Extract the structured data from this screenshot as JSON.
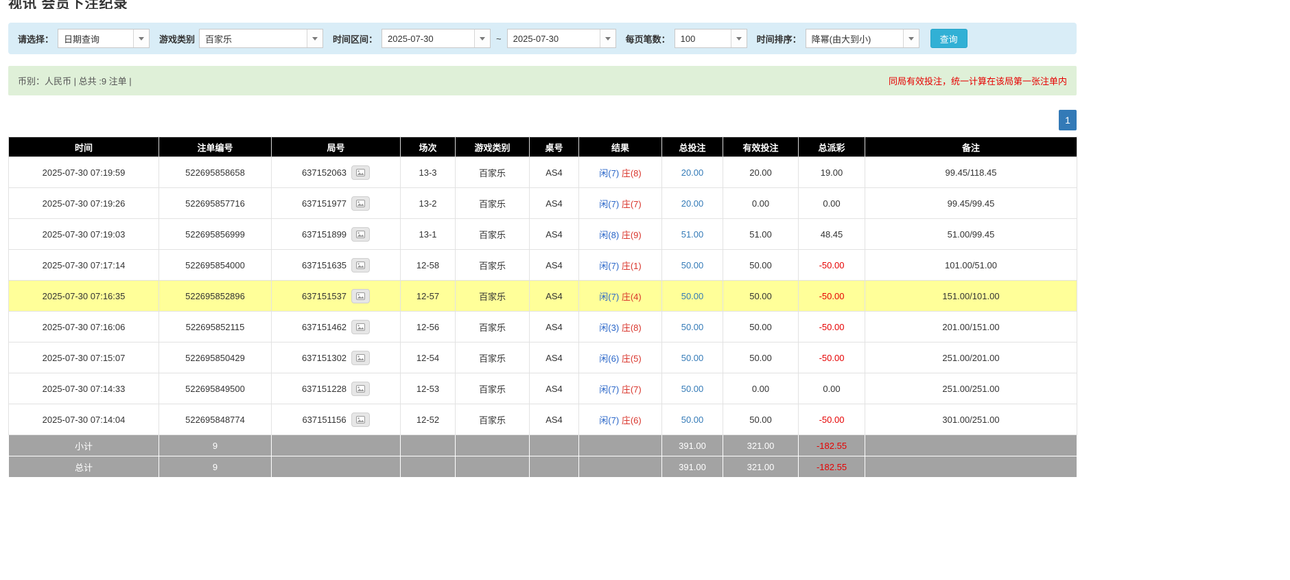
{
  "colors": {
    "filter_bar_bg": "#d9edf7",
    "summary_bar_bg": "#dff0d8",
    "table_header_bg": "#000000",
    "highlight_row_bg": "#ffff99",
    "footer_row_bg": "#a3a3a3",
    "link_blue": "#337ab7",
    "player_blue": "#2a66c8",
    "banker_red": "#d9342b",
    "negative_red": "#e60000",
    "search_button_bg": "#31b0d5",
    "pager_bg": "#337ab7"
  },
  "page": {
    "title": "视讯 会员下注纪录"
  },
  "filters": {
    "select_label": "请选择：",
    "select_value": "日期查询",
    "game_type_label": "游戏类别",
    "game_type_value": "百家乐",
    "time_range_label": "时间区间：",
    "date_from": "2025-07-30",
    "range_separator": "~",
    "date_to": "2025-07-30",
    "page_size_label": "每页笔数：",
    "page_size_value": "100",
    "sort_label": "时间排序：",
    "sort_value": "降幂(由大到小)",
    "search_button_label": "查询"
  },
  "summary": {
    "currency_info": "币别：人民币 | 总共 :9 注单 |",
    "notice": "同局有效投注，统一计算在该局第一张注单内"
  },
  "pagination": {
    "current": "1"
  },
  "icons": {
    "round_detail": "game-record-icon",
    "combo_arrow": "chevron-down-icon"
  },
  "table": {
    "headers": [
      "时间",
      "注单编号",
      "局号",
      "场次",
      "游戏类别",
      "桌号",
      "结果",
      "总投注",
      "有效投注",
      "总派彩",
      "备注"
    ],
    "rows": [
      {
        "time": "2025-07-30 07:19:59",
        "bet_id": "522695858658",
        "round": "637152063",
        "session": "13-3",
        "game": "百家乐",
        "table_no": "AS4",
        "result_player": "闲(7)",
        "result_banker": "庄(8)",
        "total_bet": "20.00",
        "valid_bet": "20.00",
        "payout": "19.00",
        "note": "99.45/118.45",
        "highlight": false
      },
      {
        "time": "2025-07-30 07:19:26",
        "bet_id": "522695857716",
        "round": "637151977",
        "session": "13-2",
        "game": "百家乐",
        "table_no": "AS4",
        "result_player": "闲(7)",
        "result_banker": "庄(7)",
        "total_bet": "20.00",
        "valid_bet": "0.00",
        "payout": "0.00",
        "note": "99.45/99.45",
        "highlight": false
      },
      {
        "time": "2025-07-30 07:19:03",
        "bet_id": "522695856999",
        "round": "637151899",
        "session": "13-1",
        "game": "百家乐",
        "table_no": "AS4",
        "result_player": "闲(8)",
        "result_banker": "庄(9)",
        "total_bet": "51.00",
        "valid_bet": "51.00",
        "payout": "48.45",
        "note": "51.00/99.45",
        "highlight": false
      },
      {
        "time": "2025-07-30 07:17:14",
        "bet_id": "522695854000",
        "round": "637151635",
        "session": "12-58",
        "game": "百家乐",
        "table_no": "AS4",
        "result_player": "闲(7)",
        "result_banker": "庄(1)",
        "total_bet": "50.00",
        "valid_bet": "50.00",
        "payout": "-50.00",
        "note": "101.00/51.00",
        "highlight": false
      },
      {
        "time": "2025-07-30 07:16:35",
        "bet_id": "522695852896",
        "round": "637151537",
        "session": "12-57",
        "game": "百家乐",
        "table_no": "AS4",
        "result_player": "闲(7)",
        "result_banker": "庄(4)",
        "total_bet": "50.00",
        "valid_bet": "50.00",
        "payout": "-50.00",
        "note": "151.00/101.00",
        "highlight": true
      },
      {
        "time": "2025-07-30 07:16:06",
        "bet_id": "522695852115",
        "round": "637151462",
        "session": "12-56",
        "game": "百家乐",
        "table_no": "AS4",
        "result_player": "闲(3)",
        "result_banker": "庄(8)",
        "total_bet": "50.00",
        "valid_bet": "50.00",
        "payout": "-50.00",
        "note": "201.00/151.00",
        "highlight": false
      },
      {
        "time": "2025-07-30 07:15:07",
        "bet_id": "522695850429",
        "round": "637151302",
        "session": "12-54",
        "game": "百家乐",
        "table_no": "AS4",
        "result_player": "闲(6)",
        "result_banker": "庄(5)",
        "total_bet": "50.00",
        "valid_bet": "50.00",
        "payout": "-50.00",
        "note": "251.00/201.00",
        "highlight": false
      },
      {
        "time": "2025-07-30 07:14:33",
        "bet_id": "522695849500",
        "round": "637151228",
        "session": "12-53",
        "game": "百家乐",
        "table_no": "AS4",
        "result_player": "闲(7)",
        "result_banker": "庄(7)",
        "total_bet": "50.00",
        "valid_bet": "0.00",
        "payout": "0.00",
        "note": "251.00/251.00",
        "highlight": false
      },
      {
        "time": "2025-07-30 07:14:04",
        "bet_id": "522695848774",
        "round": "637151156",
        "session": "12-52",
        "game": "百家乐",
        "table_no": "AS4",
        "result_player": "闲(7)",
        "result_banker": "庄(6)",
        "total_bet": "50.00",
        "valid_bet": "50.00",
        "payout": "-50.00",
        "note": "301.00/251.00",
        "highlight": false
      }
    ],
    "footer": [
      {
        "label": "小计",
        "count": "9",
        "total_bet": "391.00",
        "valid_bet": "321.00",
        "payout": "-182.55"
      },
      {
        "label": "总计",
        "count": "9",
        "total_bet": "391.00",
        "valid_bet": "321.00",
        "payout": "-182.55"
      }
    ]
  }
}
